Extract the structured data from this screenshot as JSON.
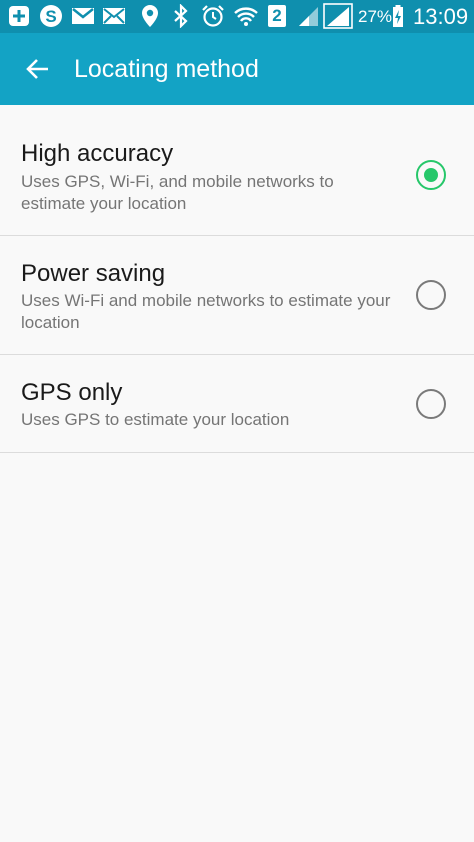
{
  "status_bar": {
    "battery_percent": "27%",
    "time": "13:09",
    "sim_number": "2",
    "icons": [
      "add-box-icon",
      "skype-icon",
      "gmail-icon",
      "email-icon",
      "location-icon",
      "bluetooth-icon",
      "alarm-icon",
      "wifi-icon",
      "sim-2-icon",
      "signal-icon",
      "signal-icon",
      "battery-charging-icon"
    ],
    "background_color": "#0f8fae"
  },
  "app_bar": {
    "title": "Locating method",
    "back_icon": "back-arrow-icon",
    "background_color": "#13a3c5"
  },
  "options": [
    {
      "title": "High accuracy",
      "description": "Uses GPS, Wi-Fi, and mobile networks to estimate your location",
      "selected": true
    },
    {
      "title": "Power saving",
      "description": "Uses Wi-Fi and mobile networks to estimate your location",
      "selected": false
    },
    {
      "title": "GPS only",
      "description": "Uses GPS to estimate your location",
      "selected": false
    }
  ],
  "colors": {
    "radio_selected": "#26c76a",
    "radio_unselected": "#7a7a7a"
  }
}
